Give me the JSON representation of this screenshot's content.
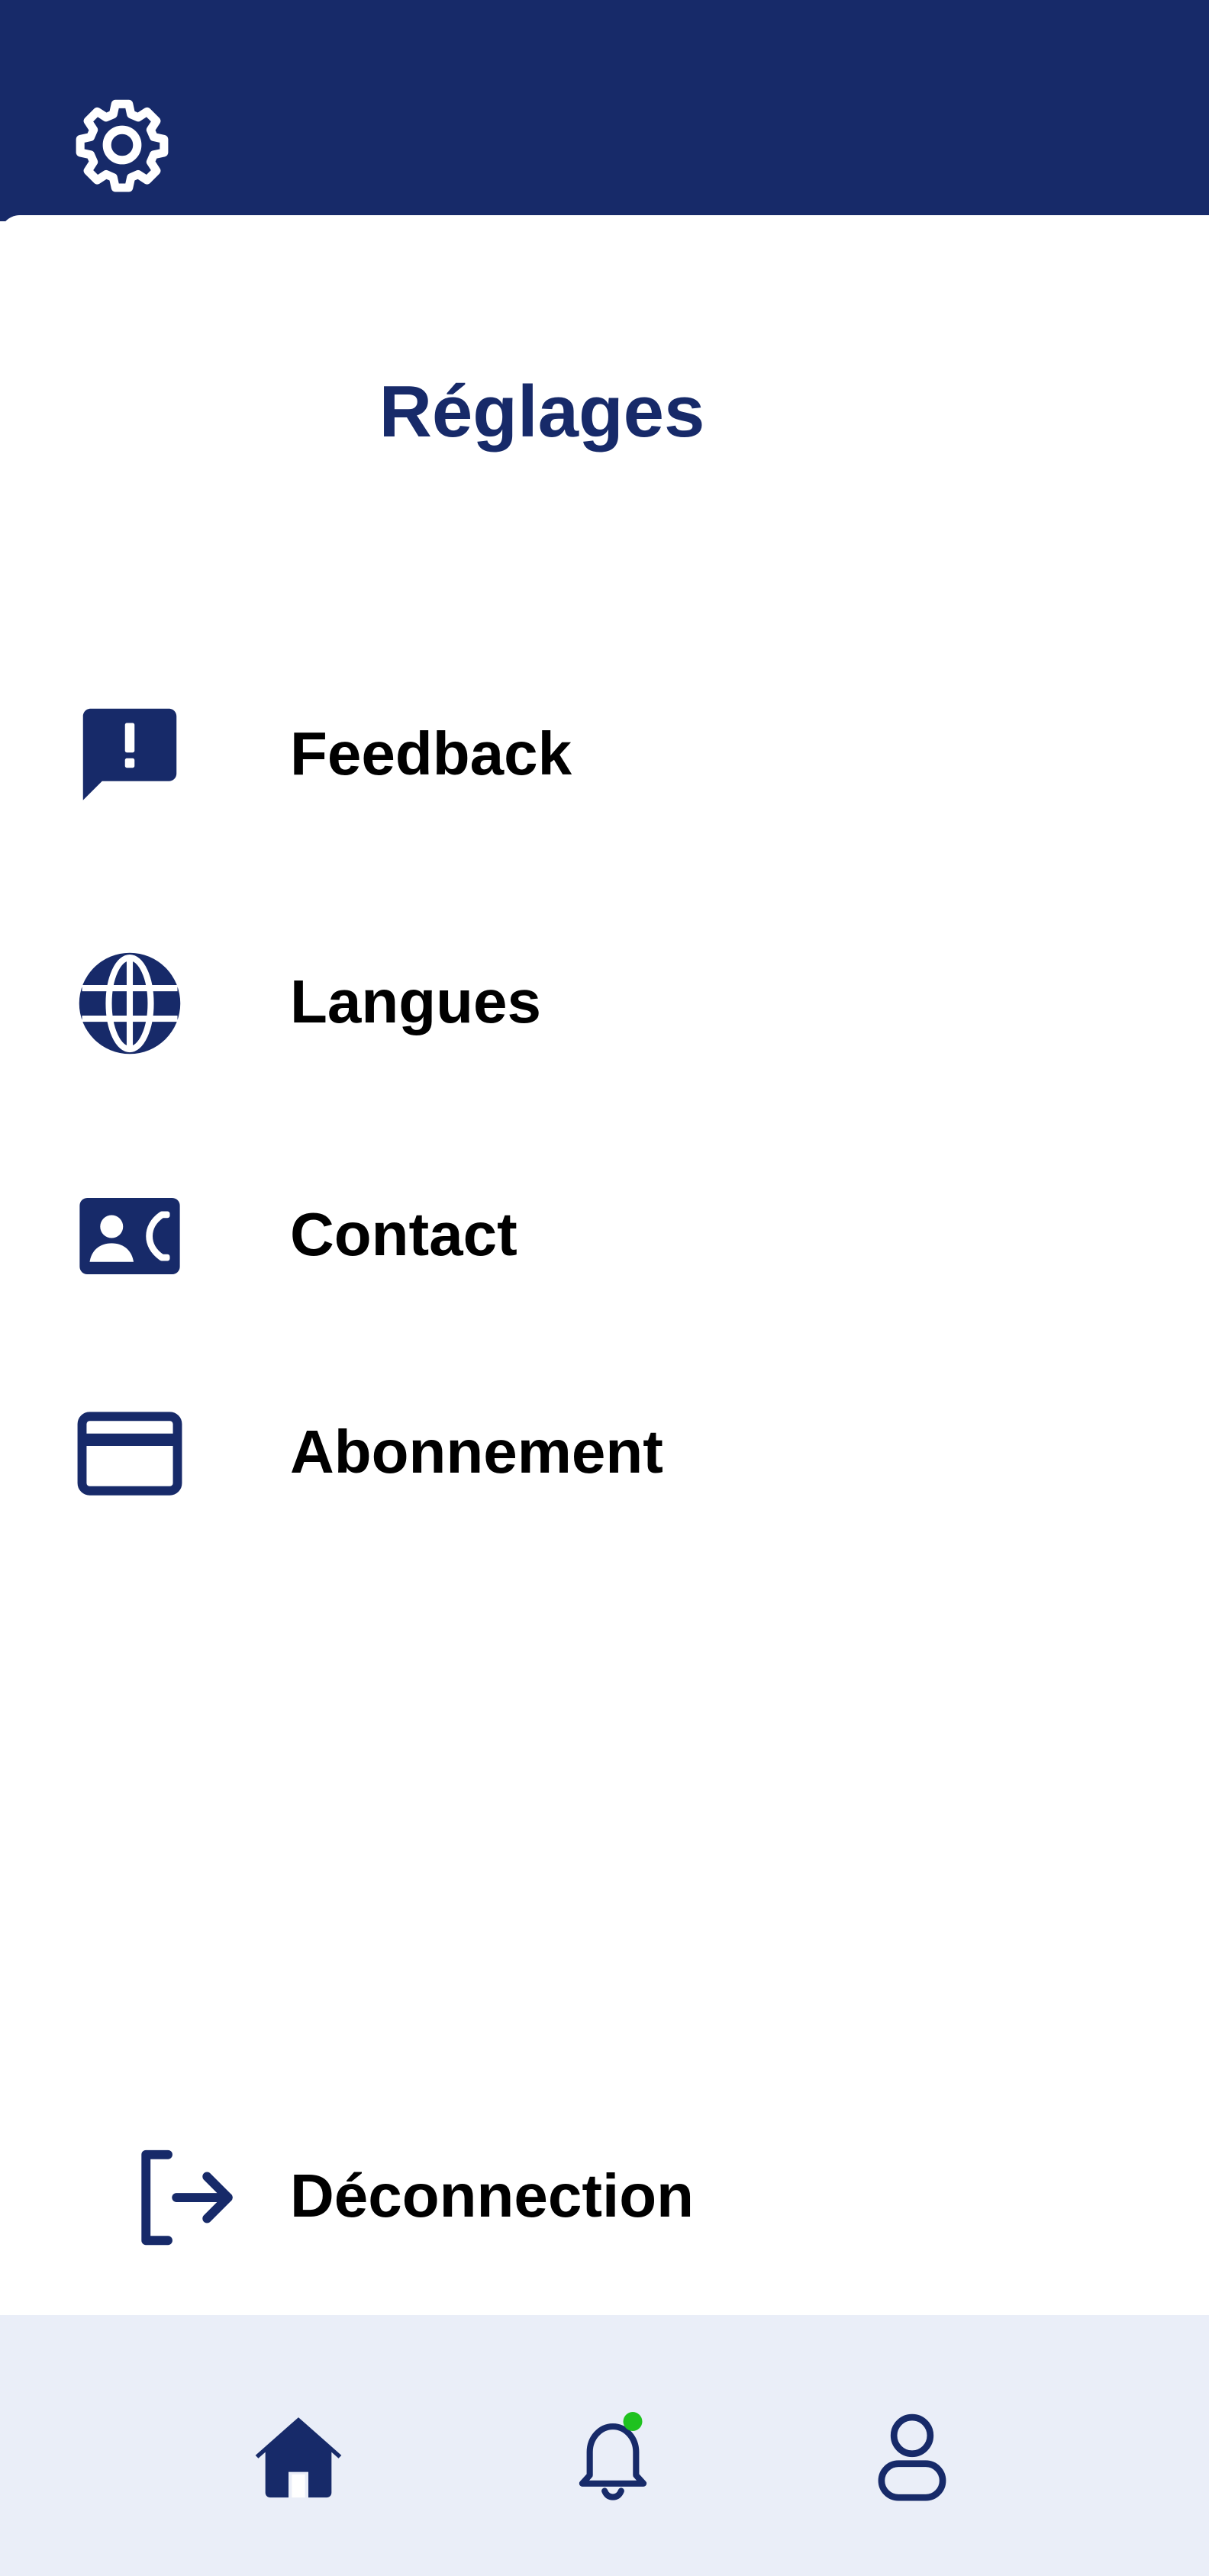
{
  "header": {
    "settings_icon": "gear-icon"
  },
  "page": {
    "title": "Réglages"
  },
  "menu": {
    "items": [
      {
        "label": "Feedback",
        "icon": "feedback-icon"
      },
      {
        "label": "Langues",
        "icon": "globe-icon"
      },
      {
        "label": "Contact",
        "icon": "contact-card-icon"
      },
      {
        "label": "Abonnement",
        "icon": "credit-card-icon"
      }
    ]
  },
  "logout": {
    "label": "Déconnection",
    "icon": "logout-icon"
  },
  "bottom_nav": {
    "items": [
      {
        "icon": "home-icon"
      },
      {
        "icon": "bell-icon",
        "has_notification_dot": true
      },
      {
        "icon": "profile-icon"
      }
    ]
  },
  "colors": {
    "primary": "#172a69",
    "nav_background": "#eaeef8",
    "notification_dot": "#1fc21f",
    "text": "#000000"
  }
}
